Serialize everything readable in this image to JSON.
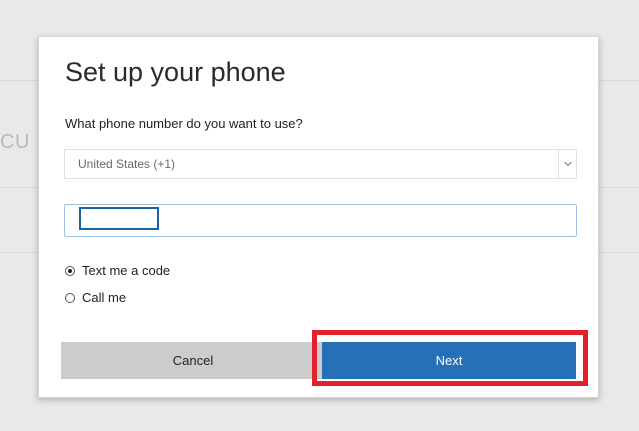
{
  "background": {
    "partial_text": "CU"
  },
  "dialog": {
    "title": "Set up your phone",
    "prompt": "What phone number do you want to use?",
    "country_select": {
      "selected": "United States (+1)"
    },
    "phone_input": {
      "value": "",
      "placeholder": ""
    },
    "methods": [
      {
        "label": "Text me a code",
        "checked": true
      },
      {
        "label": "Call me",
        "checked": false
      }
    ],
    "buttons": {
      "cancel_label": "Cancel",
      "next_label": "Next"
    }
  },
  "colors": {
    "primary_button": "#2670b8",
    "secondary_button": "#cccccc",
    "highlight": "#e2222a",
    "input_focus": "#1e5fa8"
  }
}
